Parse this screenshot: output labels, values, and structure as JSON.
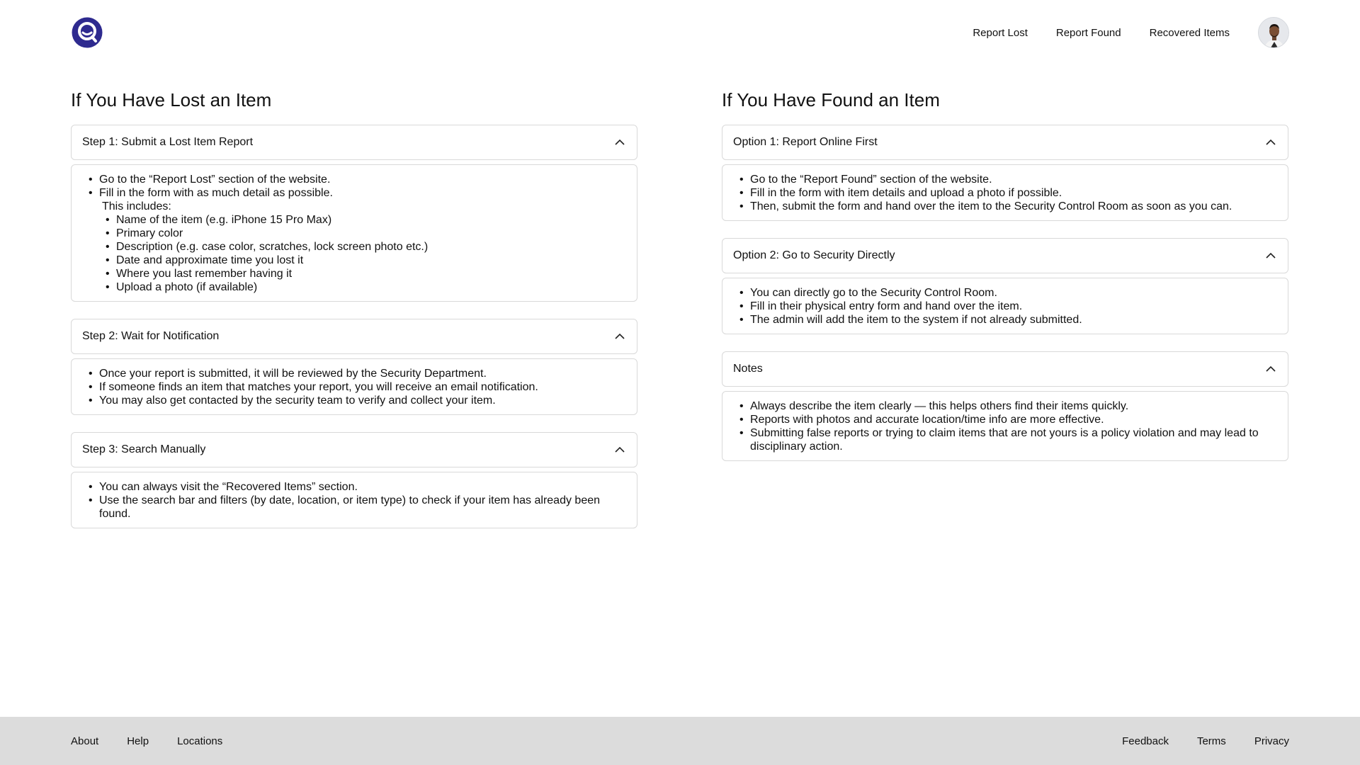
{
  "header": {
    "logo_icon": "search-logo-icon",
    "nav": [
      "Report Lost",
      "Report Found",
      "Recovered Items"
    ],
    "avatar_icon": "user-avatar-icon",
    "accent": "#2e2a8f"
  },
  "lost": {
    "heading": "If You Have Lost an Item",
    "step1": {
      "title": "Step 1: Submit a Lost Item Report",
      "items": [
        "Go to the “Report Lost” section of the website.",
        "Fill in the form with as much detail as possible."
      ],
      "intro": "This includes:",
      "sub": [
        "Name of the item (e.g. iPhone 15 Pro Max)",
        "Primary color",
        "Description (e.g. case color, scratches, lock screen photo etc.)",
        "Date and approximate time you lost it",
        "Where you last remember having it",
        "Upload a photo (if available)"
      ]
    },
    "step2": {
      "title": "Step 2: Wait for Notification",
      "items": [
        "Once your report is submitted, it will be reviewed by the Security Department.",
        "If someone finds an item that matches your report, you will receive an email notification.",
        "You may also get contacted by the security team to verify and collect your item."
      ]
    },
    "step3": {
      "title": "Step 3: Search Manually",
      "items": [
        "You can always visit the “Recovered Items” section.",
        "Use the search bar and filters (by date, location, or item type) to check if your item has already been found."
      ]
    }
  },
  "found": {
    "heading": "If You Have Found an Item",
    "option1": {
      "title": "Option 1: Report Online First",
      "items": [
        "Go to the “Report Found” section of the website.",
        "Fill in the form with item details and upload a photo if possible.",
        "Then, submit the form and hand over the item to the Security Control Room as soon as you can."
      ]
    },
    "option2": {
      "title": "Option 2: Go to Security Directly",
      "items": [
        "You can directly go to the Security Control Room.",
        "Fill in their physical entry form and hand over the item.",
        "The admin will add the item to the system if not already submitted."
      ]
    },
    "notes": {
      "title": "Notes",
      "items": [
        "Always describe the item clearly — this helps others find their items quickly.",
        "Reports with photos and accurate location/time info are more effective.",
        "Submitting false reports or trying to claim items that are not yours is a policy violation and may lead to disciplinary action."
      ]
    }
  },
  "footer": {
    "left": [
      "About",
      "Help",
      "Locations"
    ],
    "right": [
      "Feedback",
      "Terms",
      "Privacy"
    ]
  }
}
